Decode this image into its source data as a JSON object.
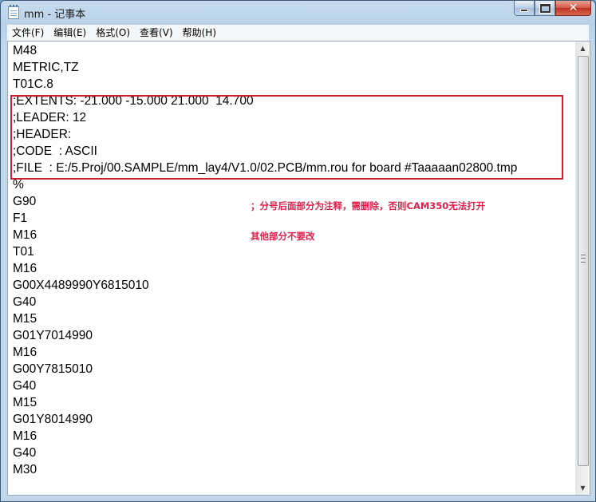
{
  "window": {
    "title": "mm - 记事本",
    "min_label": "",
    "max_label": "",
    "close_label": "✕"
  },
  "menu": {
    "items": [
      "文件(F)",
      "编辑(E)",
      "格式(O)",
      "查看(V)",
      "帮助(H)"
    ]
  },
  "editor": {
    "lines": [
      "M48",
      "METRIC,TZ",
      "T01C.8",
      ";EXTENTS: -21.000 -15.000 21.000  14.700",
      ";LEADER: 12",
      ";HEADER:",
      ";CODE  : ASCII",
      ";FILE  : E:/5.Proj/00.SAMPLE/mm_lay4/V1.0/02.PCB/mm.rou for board #Taaaaan02800.tmp",
      "%",
      "G90",
      "F1",
      "M16",
      "T01",
      "M16",
      "G00X4489990Y6815010",
      "G40",
      "M15",
      "G01Y7014990",
      "M16",
      "G00Y7815010",
      "G40",
      "M15",
      "G01Y8014990",
      "M16",
      "G40",
      "M30"
    ]
  },
  "annotations": {
    "note1": "；分号后面部分为注释，需删除，否则CAM350无法打开",
    "note2": "其他部分不要改",
    "color": "#e0204a",
    "box_color": "#d01e2a"
  },
  "scrollbar": {
    "up_glyph": "▲",
    "down_glyph": "▼"
  }
}
